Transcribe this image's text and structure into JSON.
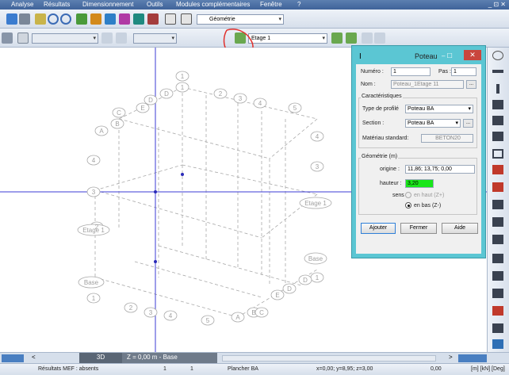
{
  "menu": [
    "Analyse",
    "Résultats",
    "Dimensionnement",
    "Outils",
    "Modules complémentaires",
    "Fenêtre",
    "?"
  ],
  "window_controls": "_ ⊡ ✕",
  "toolbar": {
    "view_combo": "Géométrie",
    "floor_combo": "Etage 1"
  },
  "canvas": {
    "axis_labels": [
      "A",
      "B",
      "C",
      "D",
      "E",
      "1",
      "2",
      "3",
      "4",
      "5",
      "Etage 1",
      "Base"
    ]
  },
  "dialog": {
    "title": "Poteau",
    "numero_label": "Numéro :",
    "numero_value": "1",
    "pas_label": "Pas :",
    "pas_value": "1",
    "nom_label": "Nom :",
    "nom_value": "Poteau_1Etage 11",
    "characteristics_label": "Caractéristiques",
    "type_profile_label": "Type de profilé",
    "type_profile_value": "Poteau BA",
    "section_label": "Section :",
    "section_value": "Poteau BA",
    "material_label": "Matériau standard:",
    "material_value": "BETON20",
    "geometry_label": "Géométrie (m)",
    "origin_label": "origine :",
    "origin_value": "11,86; 13,75; 0,00",
    "height_label": "hauteur :",
    "height_value": "3,20",
    "sens_label": "sens :",
    "sens_up": "en haut (Z+)",
    "sens_down": "en bas (Z-)",
    "btn_add": "Ajouter",
    "btn_close": "Fermer",
    "btn_help": "Aide",
    "dots": "...",
    "close_x": "✕",
    "minmax": "–  ☐"
  },
  "tabs": {
    "view_3d": "3D",
    "z_label": "Z = 0,00 m - Base"
  },
  "status": {
    "results": "Résultats MEF : absents",
    "num": "1",
    "node": "1",
    "layer": "Plancher BA",
    "coords": "x=0,00; y=8,95; z=3,00",
    "angle": "0,00",
    "units": "[m] [kN] [Deg]"
  },
  "colors": {
    "dialog_accent": "#5bc6d3",
    "height_field": "#19e619",
    "axis_line": "#3b3bd4",
    "annotation_red": "#e0302c"
  }
}
